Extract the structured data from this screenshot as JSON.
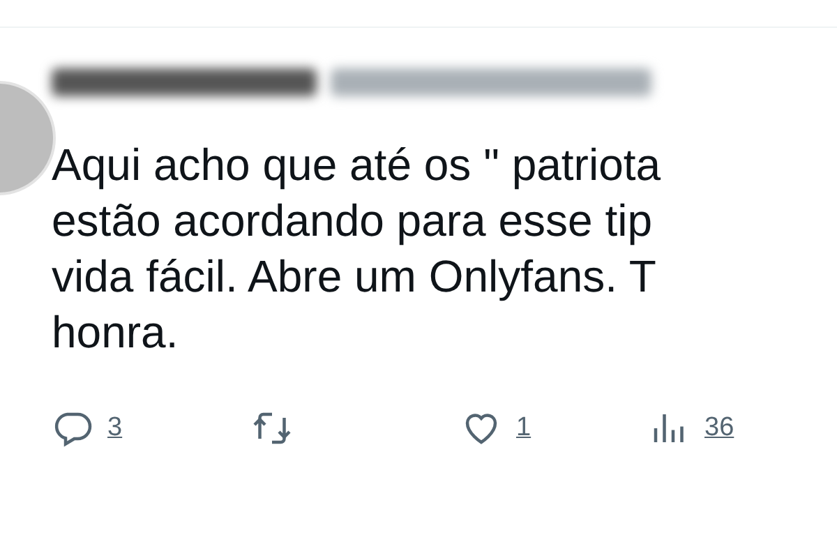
{
  "tweet": {
    "lines": [
      "Aqui acho que até os \" patriota",
      "estão acordando para esse tip",
      "vida fácil. Abre um Onlyfans. T",
      "honra."
    ]
  },
  "actions": [
    {
      "kind": "reply",
      "count": "3"
    },
    {
      "kind": "retweet"
    },
    {
      "kind": "like",
      "count": "1"
    },
    {
      "kind": "views",
      "count": "36"
    }
  ]
}
